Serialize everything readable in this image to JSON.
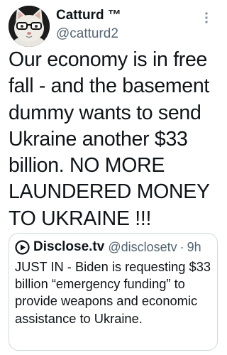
{
  "tweet": {
    "author": {
      "name": "Catturd ™",
      "handle": "@catturd2",
      "avatar_icon": "cat-avatar-icon"
    },
    "more_icon": "more-vertical-icon",
    "text": "Our economy is in free fall - and the basement dummy wants to send Ukraine another $33 billion. NO MORE LAUNDERED MONEY TO UKRAINE !!!"
  },
  "quoted_tweet": {
    "author_name": "Disclose.tv",
    "author_handle": "@disclosetv",
    "separator": "·",
    "time": "9h",
    "avatar_icon": "play-logo-icon",
    "text": "JUST IN - Biden is requesting $33 billion “emergency funding” to provide weapons and economic assistance to Ukraine."
  },
  "colors": {
    "text_primary": "#0f1419",
    "text_secondary": "#536471",
    "border": "#cfd9de",
    "background": "#ffffff"
  }
}
